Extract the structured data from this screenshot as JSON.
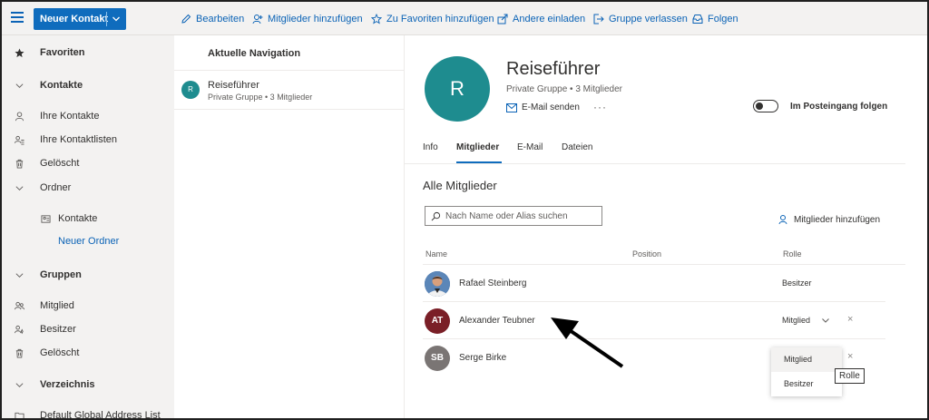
{
  "toolbar": {
    "new_contact_label": "Neuer Kontakt",
    "items": [
      {
        "label": "Bearbeiten",
        "icon": "pencil-icon"
      },
      {
        "label": "Mitglieder hinzufügen",
        "icon": "person-add-icon"
      },
      {
        "label": "Zu Favoriten hinzufügen",
        "icon": "star-add-icon"
      },
      {
        "label": "Andere einladen",
        "icon": "share-icon"
      },
      {
        "label": "Gruppe verlassen",
        "icon": "sign-out-icon"
      },
      {
        "label": "Folgen",
        "icon": "inbox-follow-icon"
      }
    ]
  },
  "leftnav": {
    "favorites": "Favoriten",
    "contacts_header": "Kontakte",
    "my_contacts": "Ihre Kontakte",
    "contact_lists": "Ihre Kontaktlisten",
    "deleted1": "Gelöscht",
    "folders": "Ordner",
    "folder_contacts": "Kontakte",
    "new_folder": "Neuer Ordner",
    "groups_header": "Gruppen",
    "member": "Mitglied",
    "owner": "Besitzer",
    "deleted2": "Gelöscht",
    "directory_header": "Verzeichnis",
    "global_list": "Default Global Address List"
  },
  "middle": {
    "header": "Aktuelle Navigation",
    "item": {
      "initial": "R",
      "title": "Reiseführer",
      "subtitle": "Private Gruppe • 3 Mitglieder"
    }
  },
  "detail": {
    "avatar_initial": "R",
    "group_name": "Reiseführer",
    "group_sub": "Private Gruppe • 3 Mitglieder",
    "email_send": "E-Mail senden",
    "more": "···",
    "follow_label": "Im Posteingang folgen",
    "tabs": [
      "Info",
      "Mitglieder",
      "E-Mail",
      "Dateien"
    ],
    "members_title": "Alle Mitglieder",
    "search_placeholder": "Nach Name oder Alias suchen",
    "add_members": "Mitglieder hinzufügen",
    "columns": {
      "name": "Name",
      "position": "Position",
      "role": "Rolle"
    },
    "members": [
      {
        "name": "Rafael Steinberg",
        "initials": "",
        "role": "Besitzer",
        "color": "#3a5a8c"
      },
      {
        "name": "Alexander Teubner",
        "initials": "AT",
        "role": "Mitglied",
        "color": "#7a1f27"
      },
      {
        "name": "Serge Birke",
        "initials": "SB",
        "role": "",
        "color": "#7a7574"
      }
    ],
    "remove_glyph": "×",
    "dropdown_options": [
      "Mitglied",
      "Besitzer"
    ],
    "tooltip": "Rolle"
  },
  "colors": {
    "accent": "#0f6cbd",
    "group_avatar": "#1e8c8f"
  }
}
